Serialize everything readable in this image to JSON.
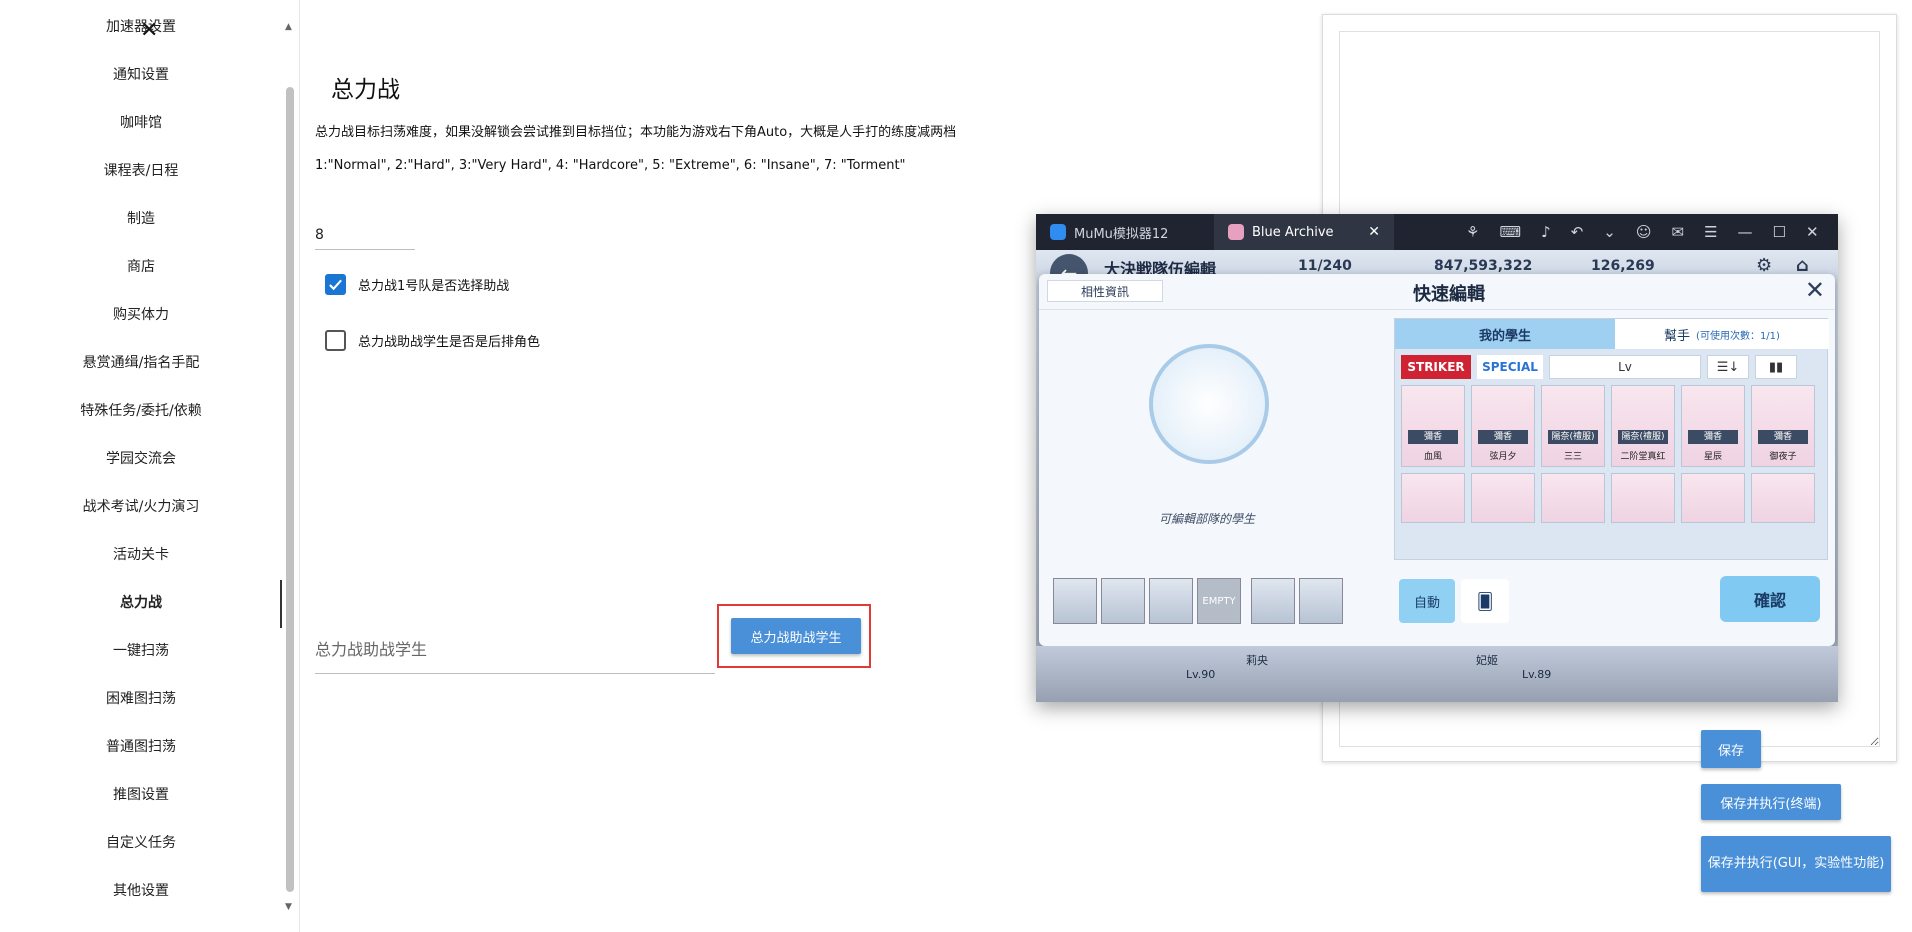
{
  "sidebar": {
    "items": [
      {
        "label": "加速器设置"
      },
      {
        "label": "通知设置"
      },
      {
        "label": "咖啡馆"
      },
      {
        "label": "课程表/日程"
      },
      {
        "label": "制造"
      },
      {
        "label": "商店"
      },
      {
        "label": "购买体力"
      },
      {
        "label": "悬赏通缉/指名手配"
      },
      {
        "label": "特殊任务/委托/依赖"
      },
      {
        "label": "学园交流会"
      },
      {
        "label": "战术考试/火力演习"
      },
      {
        "label": "活动关卡"
      },
      {
        "label": "总力战"
      },
      {
        "label": "一键扫荡"
      },
      {
        "label": "困难图扫荡"
      },
      {
        "label": "普通图扫荡"
      },
      {
        "label": "推图设置"
      },
      {
        "label": "自定义任务"
      },
      {
        "label": "其他设置"
      }
    ],
    "active": "总力战",
    "close_glyph": "✕"
  },
  "main": {
    "title": "总力战",
    "description": "总力战目标扫荡难度，如果没解锁会尝试推到目标挡位；本功能为游戏右下角Auto，大概是人手打的练度减两档",
    "levels": "1:\"Normal\", 2:\"Hard\", 3:\"Very Hard\", 4: \"Hardcore\", 5: \"Extreme\", 6: \"Insane\", 7: \"Torment\"",
    "difficulty_value": "8",
    "checkbox1_label": "总力战1号队是否选择助战",
    "checkbox1_checked": true,
    "checkbox2_label": "总力战助战学生是否是后排角色",
    "checkbox2_checked": false,
    "helper_placeholder": "总力战助战学生",
    "helper_button": "总力战助战学生"
  },
  "right_panel": {
    "save": "保存",
    "save_run": "保存并执行(终端)",
    "save_run_gui": "保存并执行(GUI，实验性功能)"
  },
  "screenshot": {
    "tab1": "MuMu模拟器12",
    "tab2": "Blue Archive",
    "tab_close": "✕",
    "game_title": "大決戦隊伍編輯",
    "ap": "11/240",
    "credits": "847,593,322",
    "pyroxene": "126,269",
    "affinity": "相性資訊",
    "dialog_title": "快速編輯",
    "dialog_close": "✕",
    "caption": "可編輯部隊的學生",
    "tab_my": "我的學生",
    "tab_helper": "幫手",
    "helper_uses": "(可使用次數：1/1)",
    "striker": "STRIKER",
    "special": "SPECIAL",
    "sort_label": "Lv",
    "cards": [
      {
        "role": "彌香",
        "name": "血風"
      },
      {
        "role": "彌香",
        "name": "弦月夕"
      },
      {
        "role": "陽奈(禮服)",
        "name": "三三"
      },
      {
        "role": "陽奈(禮服)",
        "name": "二阶堂真红"
      },
      {
        "role": "彌香",
        "name": "星辰"
      },
      {
        "role": "彌香",
        "name": "御夜子"
      }
    ],
    "empty_label": "EMPTY",
    "auto": "自動",
    "confirm": "確認",
    "bottom_name1": "莉央",
    "bottom_name2": "妃姬",
    "bottom_lv1": "Lv.90",
    "bottom_lv2": "Lv.89"
  }
}
